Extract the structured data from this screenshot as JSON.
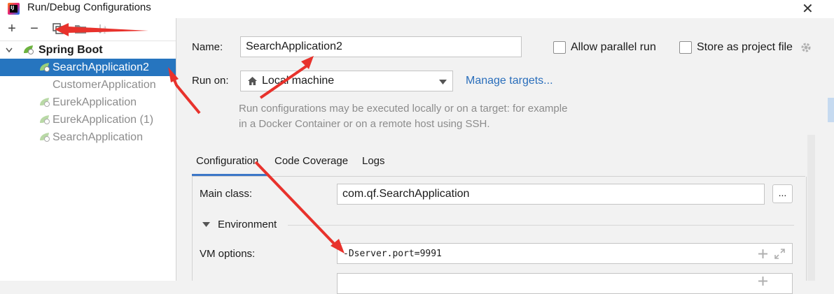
{
  "window": {
    "title": "Run/Debug Configurations",
    "close_glyph": "✕"
  },
  "toolbar": {
    "add": "+",
    "remove": "−"
  },
  "tree": {
    "group": "Spring Boot",
    "items": [
      {
        "label": "SearchApplication2",
        "selected": true
      },
      {
        "label": "CustomerApplication"
      },
      {
        "label": "EurekApplication"
      },
      {
        "label": "EurekApplication (1)"
      },
      {
        "label": "SearchApplication"
      }
    ]
  },
  "form": {
    "name_label": "Name:",
    "name_value": "SearchApplication2",
    "allow_parallel_label": "Allow parallel run",
    "store_project_label": "Store as project file",
    "run_on_label": "Run on:",
    "run_on_value": "Local machine",
    "manage_targets": "Manage targets...",
    "hint": "Run configurations may be executed locally or on a target: for example in a Docker Container or on a remote host using SSH."
  },
  "tabs": [
    "Configuration",
    "Code Coverage",
    "Logs"
  ],
  "config": {
    "main_class_label": "Main class:",
    "main_class_value": "com.qf.SearchApplication",
    "browse_button": "...",
    "environment_label": "Environment",
    "vm_options_label": "VM options:",
    "vm_options_value": "-Dserver.port=9991"
  },
  "colors": {
    "selection": "#2675bf",
    "link": "#2a6ebb",
    "annotation_arrow": "#e8322c"
  }
}
